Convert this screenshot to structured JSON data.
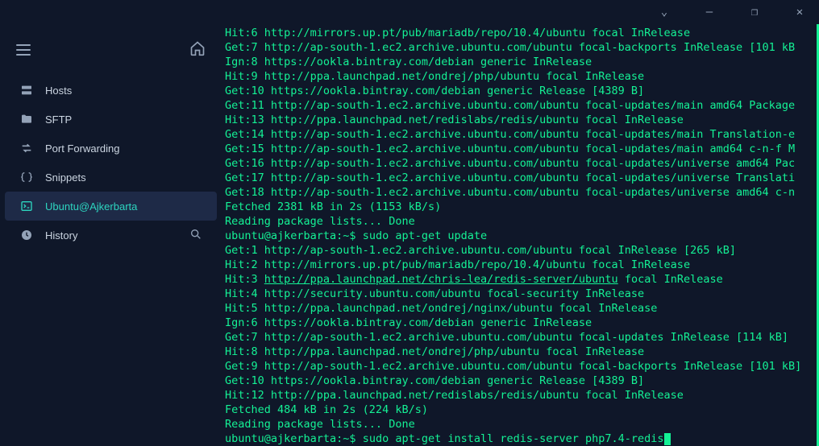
{
  "titlebar": {
    "dropdown": "⌄",
    "minimize": "—",
    "maximize": "❐",
    "close": "✕"
  },
  "sidebar": {
    "items": [
      {
        "label": "Hosts"
      },
      {
        "label": "SFTP"
      },
      {
        "label": "Port Forwarding"
      },
      {
        "label": "Snippets"
      },
      {
        "label": "Ubuntu@Ajkerbarta"
      },
      {
        "label": "History"
      }
    ]
  },
  "terminal": {
    "lines": [
      "Hit:6 http://mirrors.up.pt/pub/mariadb/repo/10.4/ubuntu focal InRelease",
      "Get:7 http://ap-south-1.ec2.archive.ubuntu.com/ubuntu focal-backports InRelease [101 kB",
      "Ign:8 https://ookla.bintray.com/debian generic InRelease",
      "Hit:9 http://ppa.launchpad.net/ondrej/php/ubuntu focal InRelease",
      "Get:10 https://ookla.bintray.com/debian generic Release [4389 B]",
      "Get:11 http://ap-south-1.ec2.archive.ubuntu.com/ubuntu focal-updates/main amd64 Package",
      "Hit:13 http://ppa.launchpad.net/redislabs/redis/ubuntu focal InRelease",
      "Get:14 http://ap-south-1.ec2.archive.ubuntu.com/ubuntu focal-updates/main Translation-e",
      "Get:15 http://ap-south-1.ec2.archive.ubuntu.com/ubuntu focal-updates/main amd64 c-n-f M",
      "Get:16 http://ap-south-1.ec2.archive.ubuntu.com/ubuntu focal-updates/universe amd64 Pac",
      "Get:17 http://ap-south-1.ec2.archive.ubuntu.com/ubuntu focal-updates/universe Translati",
      "Get:18 http://ap-south-1.ec2.archive.ubuntu.com/ubuntu focal-updates/universe amd64 c-n",
      "Fetched 2381 kB in 2s (1153 kB/s)",
      "Reading package lists... Done"
    ],
    "prompt1": {
      "user": "ubuntu@ajkerbarta:~$ ",
      "cmd": "sudo apt-get update"
    },
    "lines2": [
      "Get:1 http://ap-south-1.ec2.archive.ubuntu.com/ubuntu focal InRelease [265 kB]",
      "Hit:2 http://mirrors.up.pt/pub/mariadb/repo/10.4/ubuntu focal InRelease"
    ],
    "line_hit3_pre": "Hit:3 ",
    "line_hit3_url": "http://ppa.launchpad.net/chris-lea/redis-server/ubuntu",
    "line_hit3_post": " focal InRelease",
    "lines3": [
      "Hit:4 http://security.ubuntu.com/ubuntu focal-security InRelease",
      "Hit:5 http://ppa.launchpad.net/ondrej/nginx/ubuntu focal InRelease",
      "Ign:6 https://ookla.bintray.com/debian generic InRelease",
      "Get:7 http://ap-south-1.ec2.archive.ubuntu.com/ubuntu focal-updates InRelease [114 kB]",
      "Hit:8 http://ppa.launchpad.net/ondrej/php/ubuntu focal InRelease",
      "Get:9 http://ap-south-1.ec2.archive.ubuntu.com/ubuntu focal-backports InRelease [101 kB]",
      "Get:10 https://ookla.bintray.com/debian generic Release [4389 B]",
      "Hit:12 http://ppa.launchpad.net/redislabs/redis/ubuntu focal InRelease",
      "Fetched 484 kB in 2s (224 kB/s)",
      "Reading package lists... Done"
    ],
    "prompt2": {
      "user": "ubuntu@ajkerbarta:~$ ",
      "cmd": "sudo apt-get install redis-server php7.4-redis"
    }
  }
}
